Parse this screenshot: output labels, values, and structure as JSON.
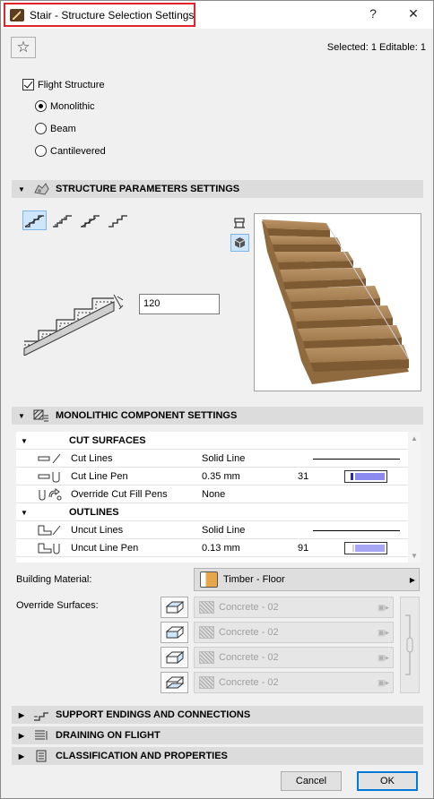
{
  "window": {
    "title": "Stair - Structure Selection Settings",
    "help_label": "?",
    "close_label": "✕"
  },
  "header": {
    "favorites_glyph": "☆",
    "selection_info": "Selected: 1 Editable: 1"
  },
  "flight_structure": {
    "label": "Flight Structure",
    "checked": true,
    "options": [
      "Monolithic",
      "Beam",
      "Cantilevered"
    ],
    "selected": "Monolithic"
  },
  "panels": {
    "structure_params": "STRUCTURE PARAMETERS SETTINGS",
    "monolithic_components": "MONOLITHIC COMPONENT SETTINGS",
    "support_endings": "SUPPORT ENDINGS AND CONNECTIONS",
    "draining": "DRAINING ON FLIGHT",
    "classification": "CLASSIFICATION AND PROPERTIES"
  },
  "structure_params": {
    "thickness_value": "120"
  },
  "component_table": {
    "groups": [
      {
        "title": "CUT SURFACES",
        "rows": [
          {
            "name": "Cut Lines",
            "value": "Solid Line",
            "pen": ""
          },
          {
            "name": "Cut Line Pen",
            "value": "0.35 mm",
            "pen": "31"
          },
          {
            "name": "Override Cut Fill Pens",
            "value": "None",
            "pen": ""
          }
        ]
      },
      {
        "title": "OUTLINES",
        "rows": [
          {
            "name": "Uncut Lines",
            "value": "Solid Line",
            "pen": ""
          },
          {
            "name": "Uncut Line Pen",
            "value": "0.13 mm",
            "pen": "91"
          }
        ]
      }
    ]
  },
  "building_material": {
    "label": "Building Material:",
    "value": "Timber - Floor"
  },
  "override_surfaces": {
    "label": "Override Surfaces:",
    "items": [
      "Concrete - 02",
      "Concrete - 02",
      "Concrete - 02",
      "Concrete - 02"
    ]
  },
  "footer": {
    "cancel": "Cancel",
    "ok": "OK"
  },
  "colors": {
    "title_highlight": "#e0262b",
    "selected_tool_bg": "#cde6fb",
    "pen_fill": "#8a8af0",
    "ok_border": "#0078d7",
    "timber": "#a6865a"
  }
}
